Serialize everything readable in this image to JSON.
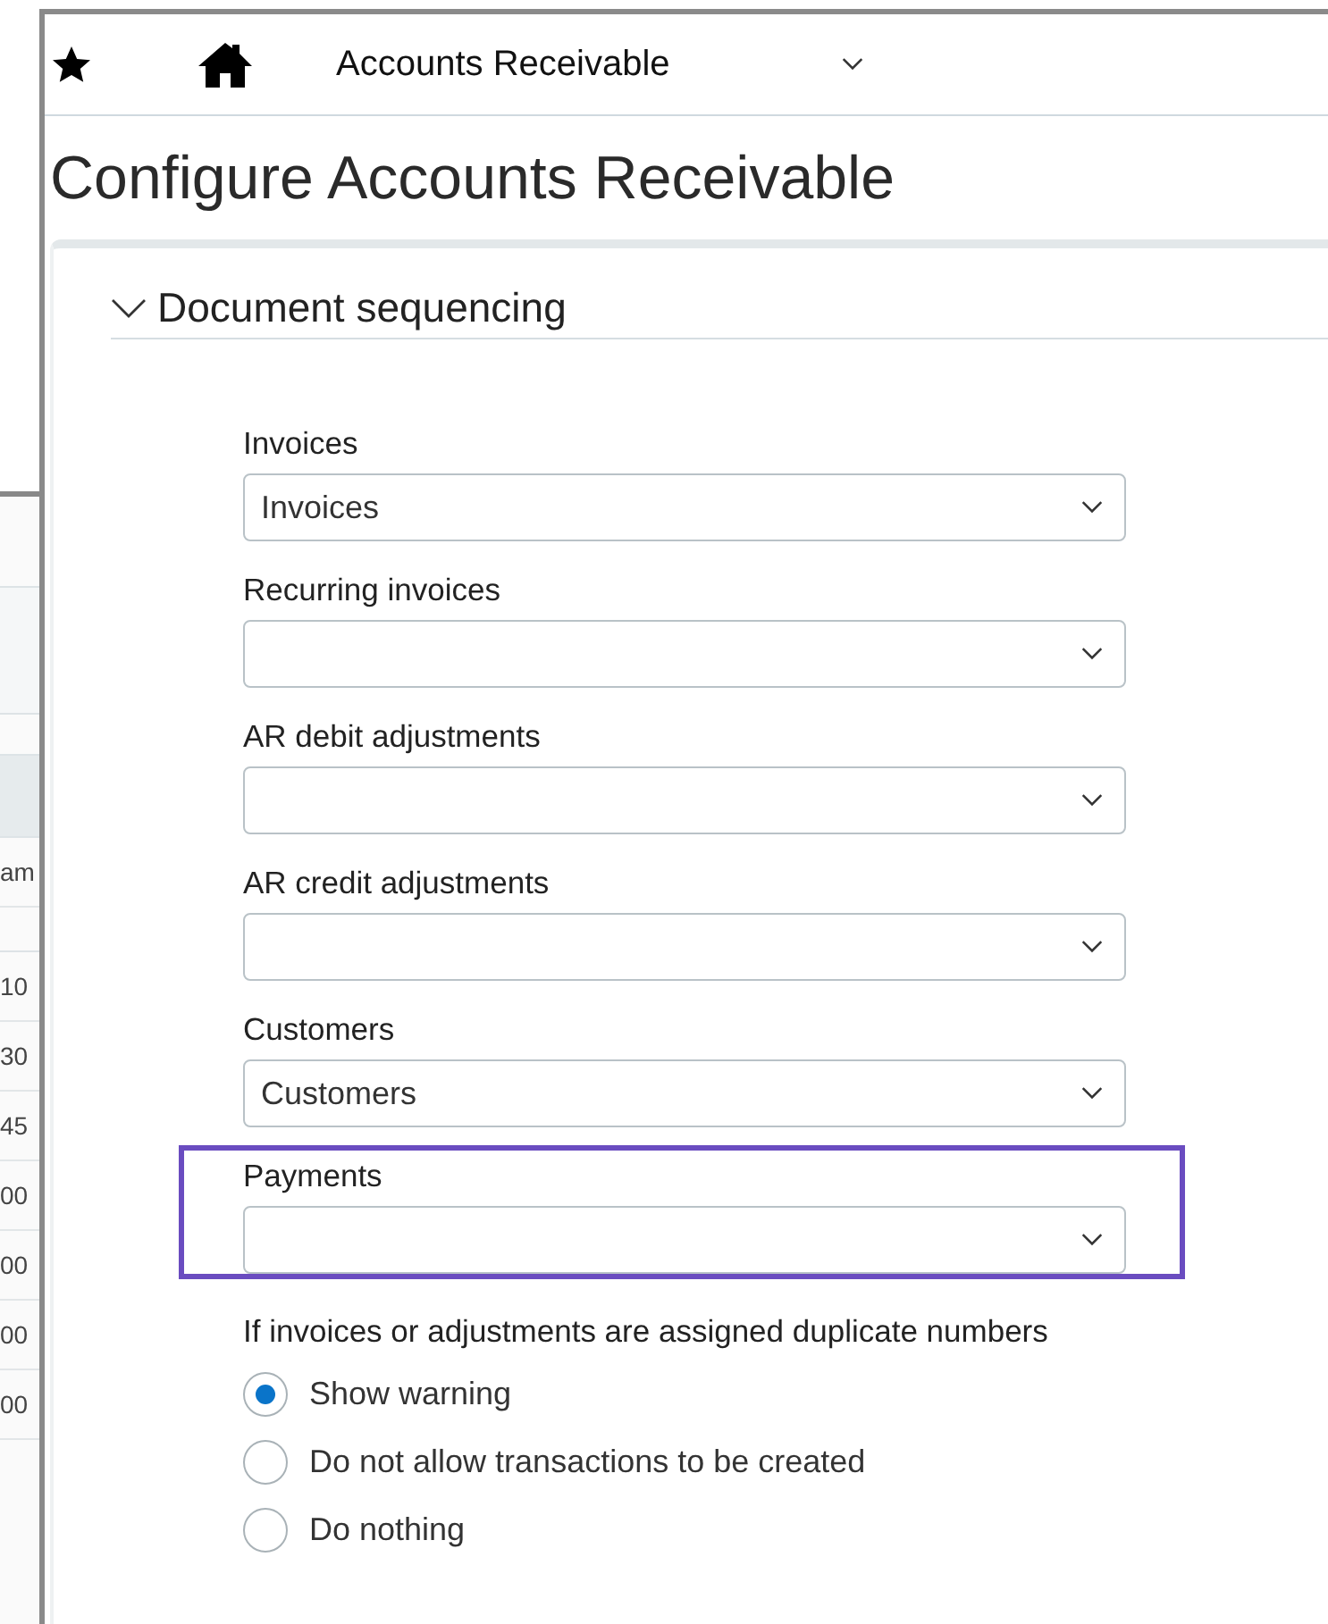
{
  "background_window": {
    "table": {
      "column_heading": "am",
      "cells": [
        "10",
        "30",
        "45",
        "00",
        "00",
        "00",
        "00"
      ]
    }
  },
  "top_bar": {
    "module": "Accounts Receivable"
  },
  "page_title": "Configure Accounts Receivable",
  "section": {
    "title": "Document sequencing",
    "expanded": true,
    "fields": [
      {
        "label": "Invoices",
        "value": "Invoices",
        "highlighted": false
      },
      {
        "label": "Recurring invoices",
        "highlighted": false
      },
      {
        "label": "AR debit adjustments",
        "highlighted": false
      },
      {
        "label": "AR credit adjustments",
        "highlighted": false
      },
      {
        "label": "Customers",
        "value": "Customers",
        "highlighted": false
      },
      {
        "label": "Payments",
        "highlighted": true
      }
    ],
    "duplicate_question": "If invoices or adjustments are assigned duplicate numbers",
    "options": [
      {
        "label": "Show warning",
        "selected": true
      },
      {
        "label": "Do not allow transactions to be created",
        "selected": false
      },
      {
        "label": "Do nothing",
        "selected": false
      }
    ]
  }
}
